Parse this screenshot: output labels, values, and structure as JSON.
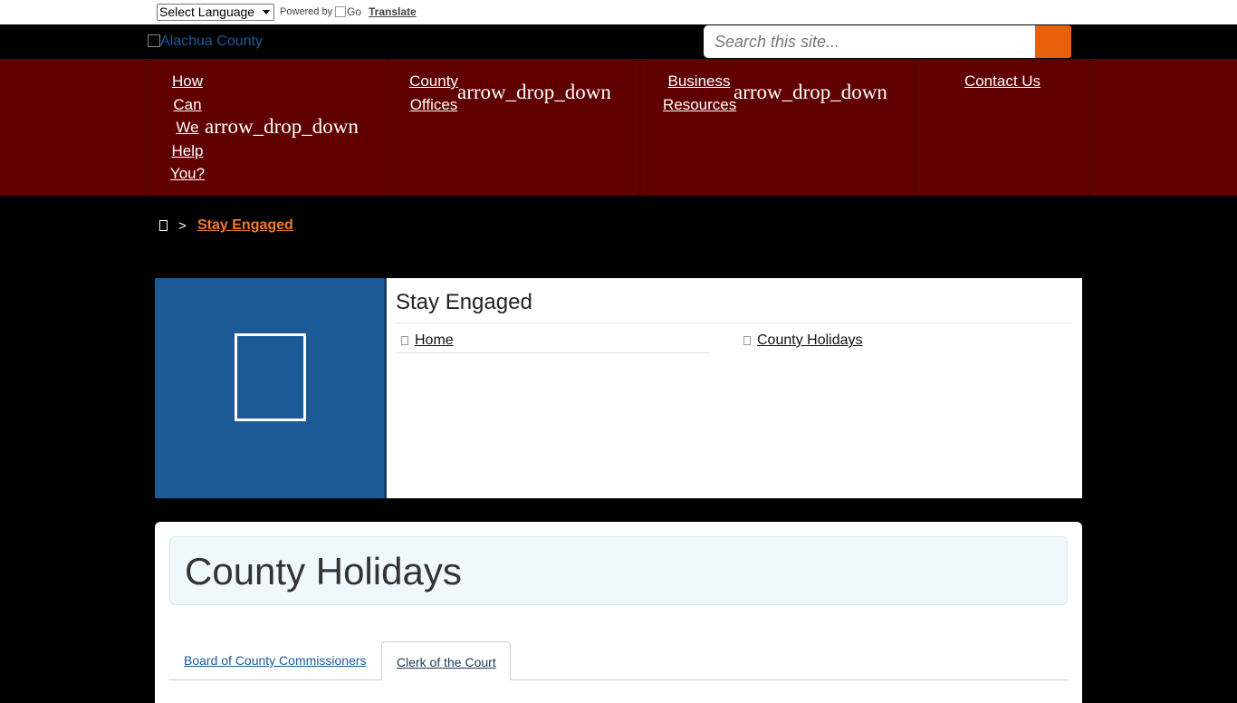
{
  "translate": {
    "select_value": "Select Language",
    "powered_by": "Powered by",
    "google_alt": "Go",
    "translate_label": "Translate"
  },
  "header": {
    "logo_alt": "Alachua County",
    "search_placeholder": "Search this site..."
  },
  "nav": {
    "items": [
      {
        "lines": [
          "How",
          "Can",
          "We",
          "Help",
          "You?"
        ],
        "arrow": "arrow_drop_down"
      },
      {
        "lines": [
          "County",
          "Offices"
        ],
        "arrow": "arrow_drop_down"
      },
      {
        "lines": [
          "Business",
          "Resources"
        ],
        "arrow": "arrow_drop_down"
      },
      {
        "lines": [
          "Contact Us"
        ]
      }
    ]
  },
  "breadcrumb": {
    "separator": ">",
    "current": "Stay Engaged"
  },
  "panel": {
    "title": "Stay Engaged",
    "links": [
      "Home",
      "County Holidays"
    ]
  },
  "content": {
    "title": "County Holidays",
    "tabs": [
      "Board of County Commissioners",
      "Clerk of the Court"
    ]
  },
  "colors": {
    "nav_bg": "#600000",
    "search_button": "#e8600a",
    "breadcrumb_active": "#f07a2a",
    "panel_blue": "#1b5a96"
  }
}
